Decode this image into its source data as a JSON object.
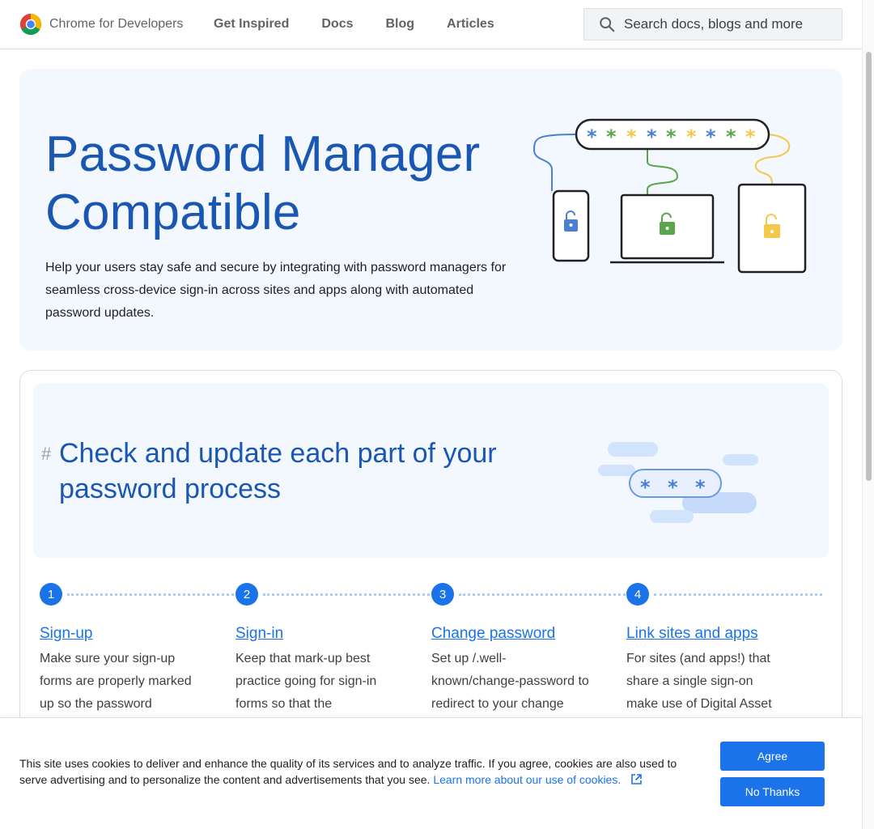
{
  "header": {
    "brand": "Chrome for Developers",
    "nav": [
      "Get Inspired",
      "Docs",
      "Blog",
      "Articles"
    ],
    "search_placeholder": "Search docs, blogs and more"
  },
  "hero": {
    "title": "Password Manager Compatible",
    "description": "Help your users stay safe and secure by integrating with password managers for seamless cross-device sign-in across sites and apps along with automated password updates."
  },
  "section": {
    "hash": "#",
    "title": "Check and update each part of your password process",
    "steps": [
      {
        "num": "1",
        "title": "Sign-up",
        "text": "Make sure your sign-up forms are properly marked up so the password"
      },
      {
        "num": "2",
        "title": "Sign-in",
        "text": "Keep that mark-up best practice going for sign-in forms so that the"
      },
      {
        "num": "3",
        "title": "Change password",
        "text": "Set up /.well-known/change-password to redirect to your change"
      },
      {
        "num": "4",
        "title": "Link sites and apps",
        "text": "For sites (and apps!) that share a single sign-on make use of Digital Asset"
      }
    ]
  },
  "cookie": {
    "text": "This site uses cookies to deliver and enhance the quality of its services and to analyze traffic. If you agree, cookies are also used to serve advertising and to personalize the content and advertisements that you see.",
    "link": "Learn more about our use of cookies.",
    "agree": "Agree",
    "no_thanks": "No Thanks"
  },
  "colors": {
    "accent": "#1a73e8",
    "title_blue": "#1a57b2",
    "hero_bg": "#f3f7fe"
  }
}
